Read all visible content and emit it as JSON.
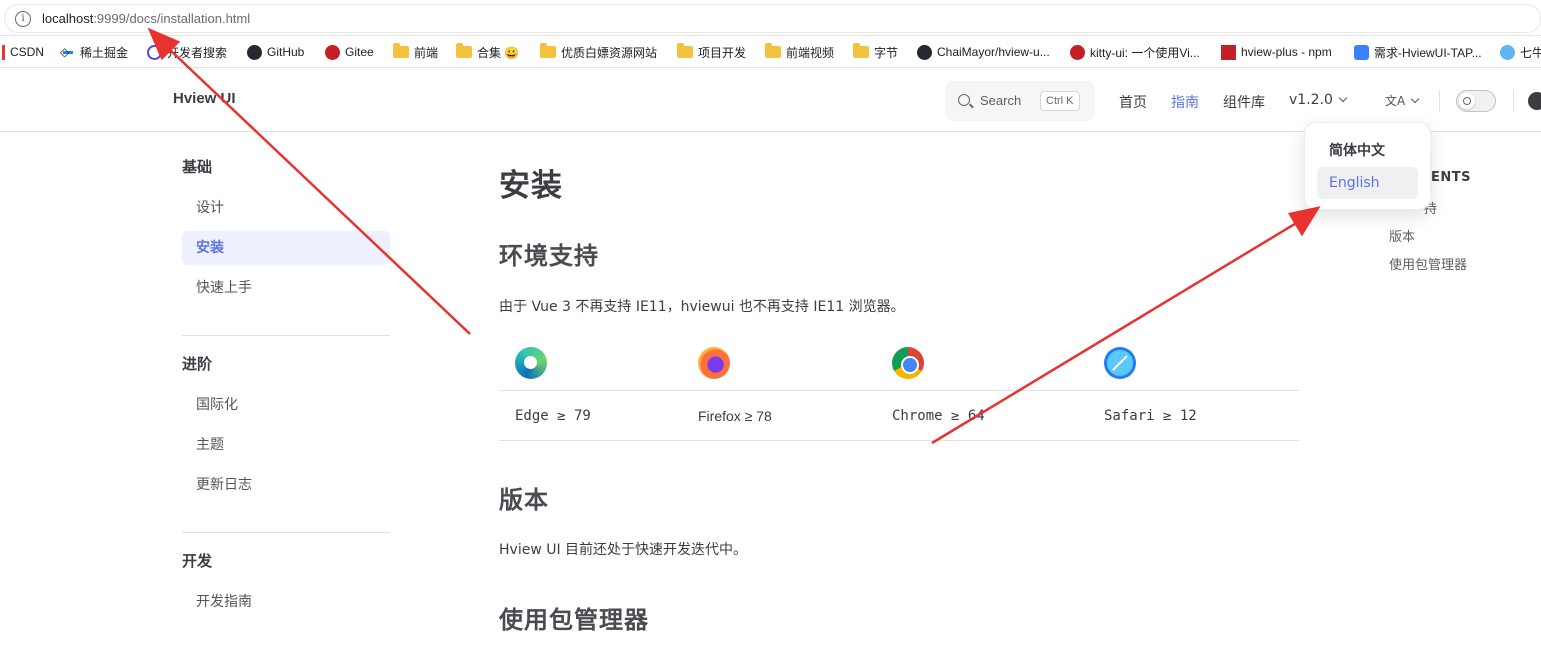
{
  "browser": {
    "url_host": "localhost",
    "url_rest": ":9999/docs/installation.html",
    "bookmarks": [
      {
        "label": "CSDN",
        "icon": "csdn-icon"
      },
      {
        "label": "稀土掘金",
        "icon": "juejin-icon"
      },
      {
        "label": "开发者搜索",
        "icon": "dev-search-icon"
      },
      {
        "label": "GitHub",
        "icon": "github-icon"
      },
      {
        "label": "Gitee",
        "icon": "gitee-icon"
      },
      {
        "label": "前端",
        "icon": "folder-icon"
      },
      {
        "label": "合集 😀",
        "icon": "folder-icon"
      },
      {
        "label": "优质白嫖资源网站",
        "icon": "folder-icon"
      },
      {
        "label": "项目开发",
        "icon": "folder-icon"
      },
      {
        "label": "前端视频",
        "icon": "folder-icon"
      },
      {
        "label": "字节",
        "icon": "folder-icon"
      },
      {
        "label": "ChaiMayor/hview-u...",
        "icon": "github-icon"
      },
      {
        "label": "kitty-ui: 一个使用Vi...",
        "icon": "gitee-icon"
      },
      {
        "label": "hview-plus - npm",
        "icon": "npm-icon"
      },
      {
        "label": "需求-HviewUI-TAP...",
        "icon": "tapd-icon"
      },
      {
        "label": "七牛",
        "icon": "qiniu-icon"
      }
    ]
  },
  "nav": {
    "brand": "Hview UI",
    "search_label": "Search",
    "search_shortcut": "Ctrl K",
    "links": [
      "首页",
      "指南",
      "组件库"
    ],
    "version": "v1.2.0",
    "translate_icon": "文A",
    "active_link": "指南"
  },
  "sidebar": {
    "groups": [
      {
        "title": "基础",
        "items": [
          "设计",
          "安装",
          "快速上手"
        ]
      },
      {
        "title": "进阶",
        "items": [
          "国际化",
          "主题",
          "更新日志"
        ]
      },
      {
        "title": "开发",
        "items": [
          "开发指南"
        ]
      }
    ],
    "active_item": "安装"
  },
  "content": {
    "title": "安装",
    "env_heading": "环境支持",
    "env_text": "由于 Vue 3 不再支持 IE11，hviewui 也不再支持 IE11 浏览器。",
    "browsers": [
      {
        "icon": "edge-icon",
        "label": "Edge ≥ 79"
      },
      {
        "icon": "firefox-icon",
        "label": "Firefox ≥ 78"
      },
      {
        "icon": "chrome-icon",
        "label": "Chrome ≥ 64"
      },
      {
        "icon": "safari-icon",
        "label": "Safari ≥ 12"
      }
    ],
    "version_heading": "版本",
    "version_text": "Hview UI 目前还处于快速开发迭代中。",
    "pm_heading": "使用包管理器"
  },
  "toc": {
    "title_visible": "ENTS",
    "items_visible": [
      "持",
      "版本",
      "使用包管理器"
    ]
  },
  "lang_menu": {
    "options": [
      "简体中文",
      "English"
    ],
    "highlighted": "English"
  },
  "colors": {
    "accent": "#5c73e7",
    "annotation": "#e8322f"
  }
}
